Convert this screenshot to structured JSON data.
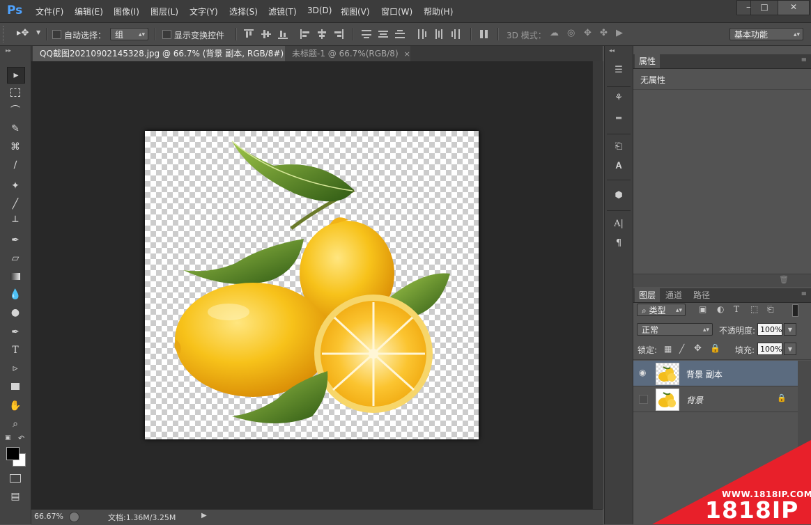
{
  "app": {
    "logo": "Ps"
  },
  "menu": [
    "文件(F)",
    "编辑(E)",
    "图像(I)",
    "图层(L)",
    "文字(Y)",
    "选择(S)",
    "滤镜(T)",
    "3D(D)",
    "视图(V)",
    "窗口(W)",
    "帮助(H)"
  ],
  "window_controls": {
    "minimize": "—",
    "maximize": "□",
    "close": "✕"
  },
  "options": {
    "auto_select_label": "自动选择：",
    "auto_select_value": "组",
    "show_transform_label": "显示变换控件",
    "mode_3d_label": "3D 模式：",
    "workspace_value": "基本功能"
  },
  "tabs": [
    {
      "label": "QQ截图20210902145328.jpg @ 66.7% (背景 副本, RGB/8#) *",
      "close": "×"
    },
    {
      "label": "未标题-1 @ 66.7%(RGB/8)",
      "close": "×"
    }
  ],
  "status": {
    "zoom": "66.67%",
    "doc": "文档:1.36M/3.25M"
  },
  "properties_panel": {
    "title": "属性",
    "content": "无属性"
  },
  "layers_panel": {
    "tabs": [
      "图层",
      "通道",
      "路径"
    ],
    "filter_label": "⌕ 类型",
    "blend_mode": "正常",
    "opacity_label": "不透明度:",
    "opacity_value": "100%",
    "lock_label": "锁定:",
    "fill_label": "填充:",
    "fill_value": "100%",
    "layers": [
      {
        "name": "背景 副本",
        "visible": true,
        "selected": true
      },
      {
        "name": "背景",
        "visible": false,
        "locked": true
      }
    ]
  },
  "watermark": {
    "url": "WWW.1818IP.COM",
    "brand": "1818IP"
  },
  "colors": {
    "accent_ps": "#4fa3ff",
    "selection": "#5b6b7f",
    "watermark_red": "#e8202a"
  }
}
